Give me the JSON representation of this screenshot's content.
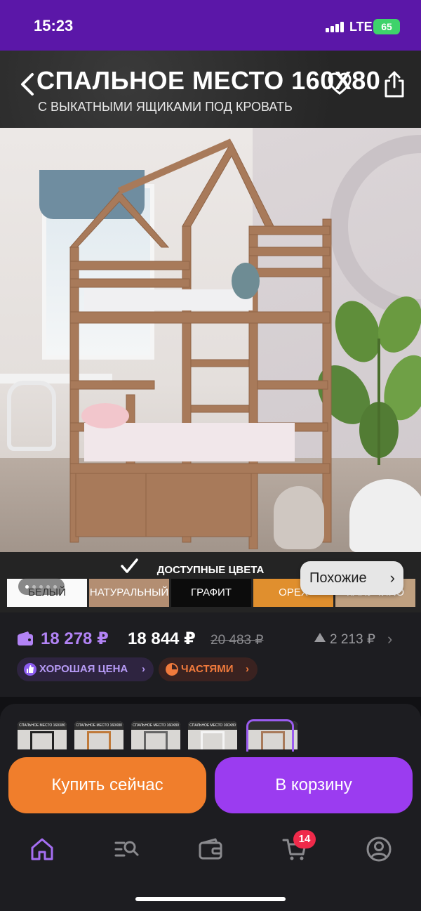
{
  "status_bar": {
    "time": "15:23",
    "network": "LTE",
    "battery": "65"
  },
  "banner": {
    "title": "СПАЛЬНОЕ МЕСТО 160X80",
    "subtitle": "С ВЫКАТНЫМИ ЯЩИКАМИ ПОД КРОВАТЬ",
    "icons": [
      "back-icon",
      "heart-icon",
      "share-icon"
    ]
  },
  "gallery": {
    "similar_label": "Похожие",
    "similar_chevron": "›",
    "dots": 5
  },
  "colors": {
    "title": "ДОСТУПНЫЕ ЦВЕТА",
    "options": [
      "БЕЛЫЙ",
      "НАТУРАЛЬНЫЙ",
      "ГРАФИТ",
      "ОРЕХ",
      "КАПУЧИНО"
    ],
    "selected": "НАТУРАЛЬНЫЙ",
    "swatch_colors": [
      "#fafafa",
      "#b38e72",
      "#0c0c0c",
      "#e08f2e",
      "#bfa080"
    ]
  },
  "price": {
    "card_price": "18 278 ₽",
    "price": "18 844 ₽",
    "old_price": "20 483 ₽",
    "delta": "2 213 ₽",
    "chevron": "›"
  },
  "badges": {
    "good_price": "ХОРОШАЯ ЦЕНА",
    "parts": "ЧАСТЯМИ",
    "chevron": "›"
  },
  "thumbnails": [
    {
      "label": "СПАЛЬНОЕ МЕСТО 160X80"
    },
    {
      "label": "СПАЛЬНОЕ МЕСТО 160X80"
    },
    {
      "label": "СПАЛЬНОЕ МЕСТО 160X80"
    },
    {
      "label": "СПАЛЬНОЕ МЕСТО 160X80"
    },
    {
      "label": ""
    }
  ],
  "actions": {
    "buy_now": "Купить сейчас",
    "add_to_cart": "В корзину"
  },
  "tabbar": {
    "tabs": [
      "home-icon",
      "catalog-search-icon",
      "wallet-icon",
      "cart-icon",
      "profile-icon"
    ],
    "cart_count": "14"
  },
  "theme": {
    "accent": "#9b3cf0",
    "orange": "#f07e2c",
    "status_bg": "#5b17a8"
  }
}
